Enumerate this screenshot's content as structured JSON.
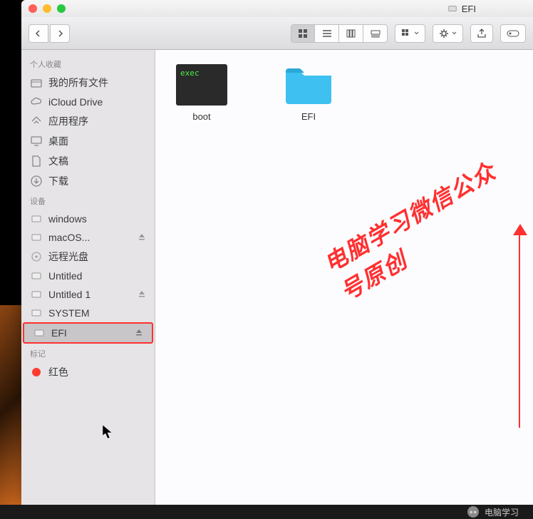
{
  "window": {
    "title": "EFI"
  },
  "sidebar": {
    "sections": [
      {
        "header": "个人收藏",
        "items": [
          {
            "icon": "all-files",
            "label": "我的所有文件"
          },
          {
            "icon": "icloud",
            "label": "iCloud Drive"
          },
          {
            "icon": "apps",
            "label": "应用程序"
          },
          {
            "icon": "desktop",
            "label": "桌面"
          },
          {
            "icon": "documents",
            "label": "文稿"
          },
          {
            "icon": "downloads",
            "label": "下载"
          }
        ]
      },
      {
        "header": "设备",
        "items": [
          {
            "icon": "disk",
            "label": "windows"
          },
          {
            "icon": "disk",
            "label": "macOS...",
            "eject": true
          },
          {
            "icon": "optical",
            "label": "远程光盘"
          },
          {
            "icon": "disk",
            "label": "Untitled"
          },
          {
            "icon": "disk",
            "label": "Untitled 1",
            "eject": true
          },
          {
            "icon": "disk",
            "label": "SYSTEM"
          },
          {
            "icon": "disk",
            "label": "EFI",
            "eject": true,
            "selected": true
          }
        ]
      },
      {
        "header": "标记",
        "items": [
          {
            "icon": "tag-red",
            "label": "红色"
          }
        ]
      }
    ]
  },
  "content": {
    "items": [
      {
        "type": "exec",
        "exec_label": "exec",
        "label": "boot"
      },
      {
        "type": "folder",
        "label": "EFI"
      }
    ]
  },
  "watermark": "电脑学习微信公众号原创",
  "footer": "电脑学习"
}
